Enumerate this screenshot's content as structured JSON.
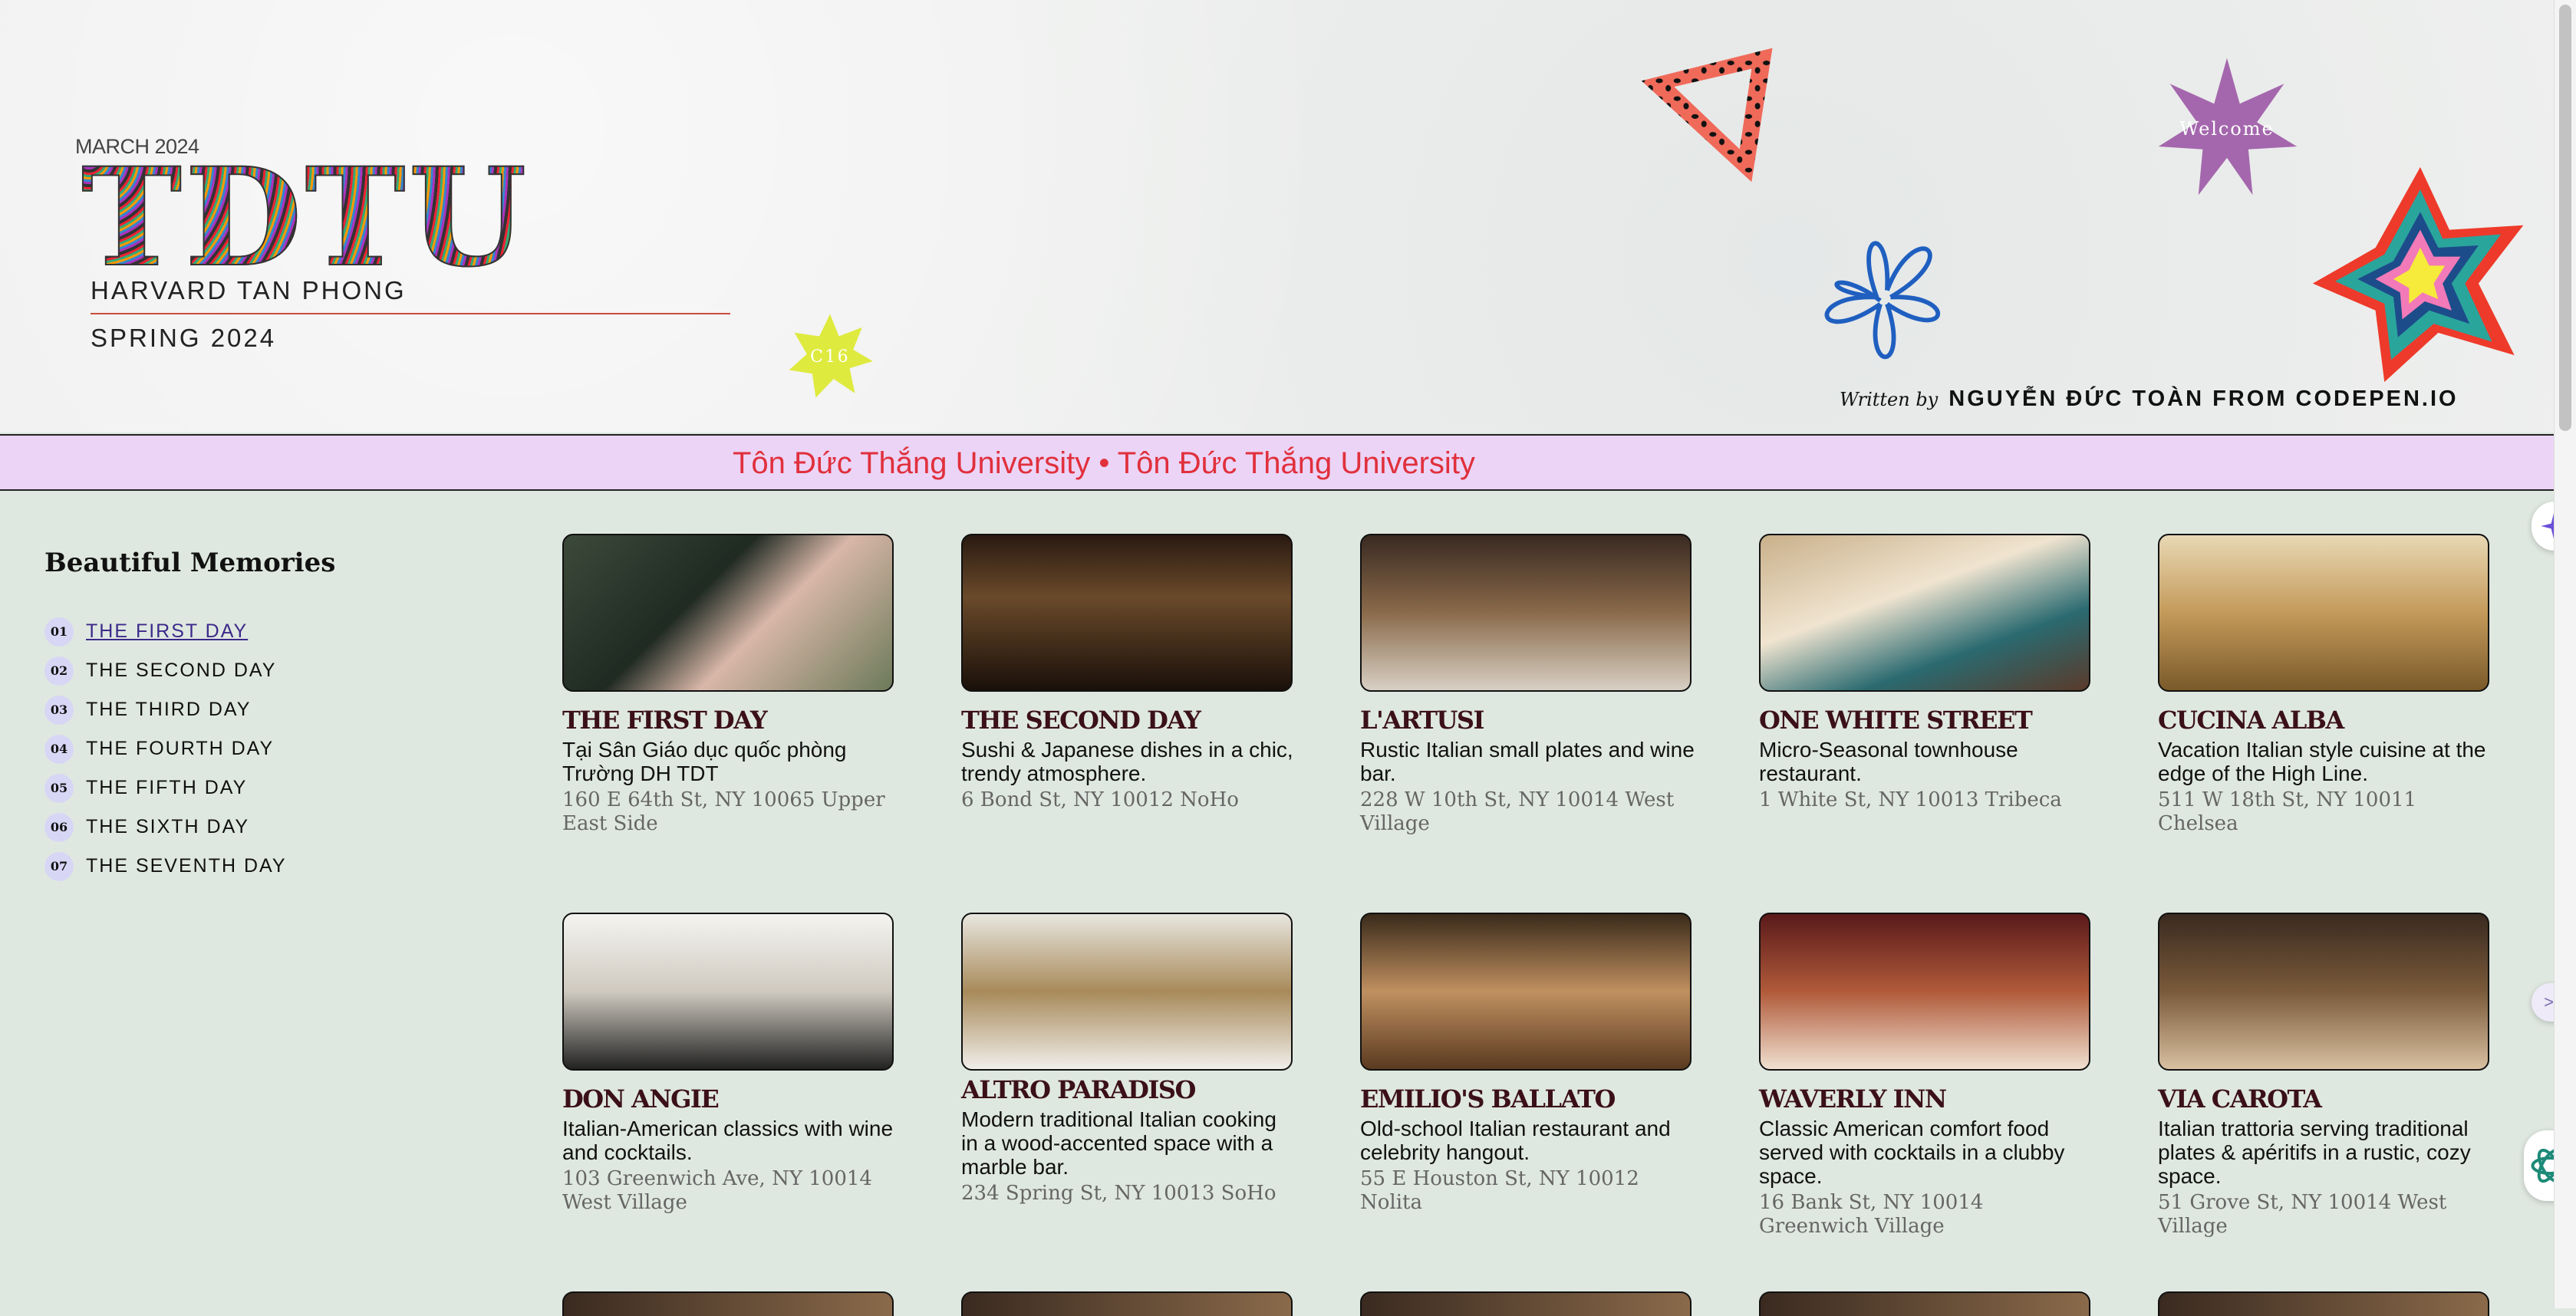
{
  "header": {
    "month": "MARCH 2024",
    "logo": "TDTU",
    "subtitle1": "HARVARD TAN PHONG",
    "subtitle2": "SPRING 2024",
    "badge_c16": "C16",
    "badge_welcome": "Welcome",
    "written_by": "Written by",
    "author": "NGUYỄN ĐỨC TOÀN FROM CODEPEN.IO"
  },
  "ticker": {
    "text": "Tôn Đức Thắng University • Tôn Đức Thắng University"
  },
  "sidebar": {
    "title": "Beautiful Memories",
    "items": [
      {
        "num": "01",
        "label": "THE FIRST DAY"
      },
      {
        "num": "02",
        "label": "THE SECOND DAY"
      },
      {
        "num": "03",
        "label": "THE THIRD DAY"
      },
      {
        "num": "04",
        "label": "THE FOURTH DAY"
      },
      {
        "num": "05",
        "label": "THE FIFTH DAY"
      },
      {
        "num": "06",
        "label": "THE SIXTH DAY"
      },
      {
        "num": "07",
        "label": "THE SEVENTH DAY"
      }
    ]
  },
  "cards": [
    {
      "title": "THE FIRST DAY",
      "desc": "Tại Sân Giáo dục quốc phòng Trường DH TDT",
      "addr": "160 E 64th St, NY 10065 Upper East Side"
    },
    {
      "title": "THE SECOND DAY",
      "desc": "Sushi & Japanese dishes in a chic, trendy atmosphere.",
      "addr": "6 Bond St, NY 10012 NoHo"
    },
    {
      "title": "L'ARTUSI",
      "desc": "Rustic Italian small plates and wine bar.",
      "addr": "228 W 10th St, NY 10014 West Village"
    },
    {
      "title": "ONE WHITE STREET",
      "desc": "Micro-Seasonal townhouse restaurant.",
      "addr": "1 White St, NY 10013 Tribeca"
    },
    {
      "title": "CUCINA ALBA",
      "desc": "Vacation Italian style cuisine at the edge of the High Line.",
      "addr": "511 W 18th St, NY 10011 Chelsea"
    },
    {
      "title": "DON ANGIE",
      "desc": "Italian-American classics with wine and cocktails.",
      "addr": "103 Greenwich Ave, NY 10014 West Village"
    },
    {
      "title": "ALTRO PARADISO",
      "desc": "Modern traditional Italian cooking in a wood-accented space with a marble bar.",
      "addr": "234 Spring St, NY 10013 SoHo"
    },
    {
      "title": "EMILIO'S BALLATO",
      "desc": "Old-school Italian restaurant and celebrity hangout.",
      "addr": "55 E Houston St, NY 10012 Nolita"
    },
    {
      "title": "WAVERLY INN",
      "desc": "Classic American comfort food served with cocktails in a clubby space.",
      "addr": "16 Bank St, NY 10014 Greenwich Village"
    },
    {
      "title": "VIA CAROTA",
      "desc": "Italian trattoria serving traditional plates & apéritifs in a rustic, cozy space.",
      "addr": "51 Grove St, NY 10014 West Village"
    }
  ],
  "colors": {
    "accent": "#e0303c",
    "ticker_bg": "#ecd4f7",
    "page_bg": "#dfe8e0",
    "title": "#3b1018"
  },
  "icons": [
    "triangle-icon",
    "welcome-star-icon",
    "flower-icon",
    "rainbow-star-icon",
    "c16-star-icon",
    "sparkle-icon",
    "collapse-icon",
    "chatgpt-icon"
  ]
}
